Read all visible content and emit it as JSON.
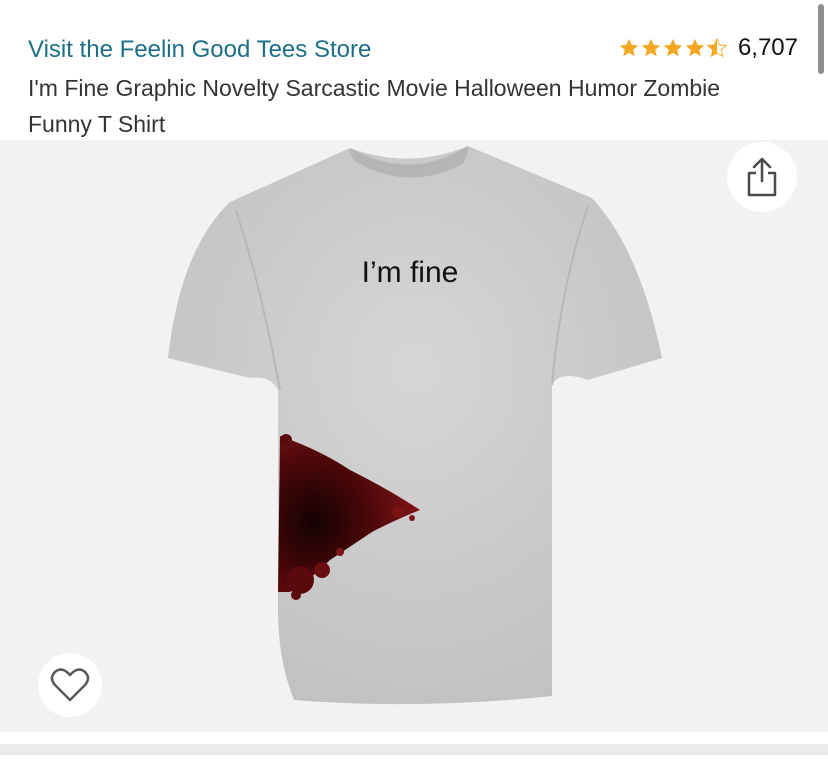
{
  "header": {
    "store_link": "Visit the Feelin Good Tees Store",
    "rating": {
      "stars": 4.5,
      "count": "6,707",
      "color": "#f5a623"
    },
    "title": "I'm Fine Graphic Novelty Sarcastic Movie Halloween Humor Zombie Funny T Shirt"
  },
  "product_image": {
    "shirt_text": "I’m fine",
    "shirt_color": "#c8c8c8",
    "stain_color": "#5a0a0d"
  },
  "icons": {
    "share": "share-icon",
    "wishlist": "heart-outline-icon",
    "star": "star-icon"
  }
}
